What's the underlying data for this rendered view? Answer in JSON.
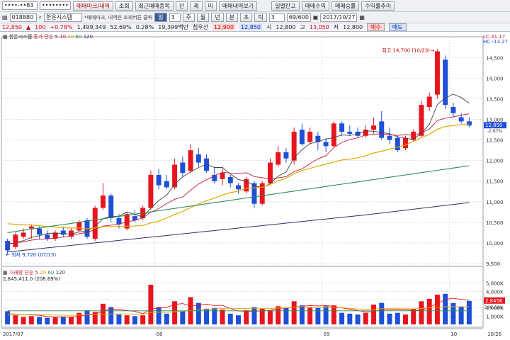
{
  "toolbar1": {
    "account_no": "••••-••83",
    "password": "••••••••",
    "buttons": [
      "매매마크/내역",
      "조회",
      "최근매매종목",
      "잔",
      "체",
      "미",
      "매매내역보기"
    ],
    "right_buttons": [
      "일별잔고",
      "매매수익",
      "매매승률",
      "수익률추이"
    ]
  },
  "toolbar2": {
    "code": "018880",
    "name": "한온시스템",
    "hint": "*매매마크, 내역은 조회버튼 클릭",
    "period": "일",
    "num": "3",
    "modes": [
      "주",
      "월",
      "년",
      "분",
      "초",
      "틱"
    ],
    "count": "3",
    "page": "69/600",
    "date": "2017/10/27"
  },
  "ticker": {
    "price": "12,850",
    "change": "100",
    "change_pct": "+0.78%",
    "volume": "1,499,349",
    "ratio": "52.69%",
    "turnover": "0.28%",
    "trade_value": "19,399백만",
    "pref": "첨우선",
    "pref_price": "12,900",
    "bid": "12,850",
    "open_label": "시",
    "open": "12,800",
    "high_label": "고",
    "high": "13,050",
    "low_label": "저",
    "low": "12,800",
    "buy": "매수",
    "sell": "매도"
  },
  "price_legend": {
    "name": "한온시스템",
    "ma_label": "종가 단순",
    "periods": [
      "5",
      "10",
      "20",
      "60",
      "120"
    ]
  },
  "volume_legend": {
    "name": "거래량",
    "ma_label": "단순",
    "periods": [
      "5",
      "20",
      "60",
      "120"
    ],
    "value": "2,845,411.0 (208.69%)"
  },
  "colors": {
    "up": "#e8141e",
    "down": "#1e4fd8",
    "ma5": "#444444",
    "ma10": "#c41e3a",
    "ma20": "#e0a800",
    "ma60": "#2e8b57",
    "ma120": "#303060",
    "grid": "#d8dde6"
  },
  "chart_data": [
    {
      "type": "candlestick",
      "title": "한온시스템",
      "x_labels": [
        "2017/07",
        "08",
        "09",
        "10",
        "10/26"
      ],
      "ylim": [
        9500,
        14900
      ],
      "y_ticks": [
        "14,500",
        "14,000",
        "13,500",
        "13,000",
        "12,500",
        "12,000",
        "11,500",
        "11,000",
        "10,500",
        "10,000",
        "9,500"
      ],
      "current_label": "12,850",
      "current_value": 12850,
      "lc_label": "LC:31.17",
      "hc_label": "HC:-13.27",
      "pivot_label": "-2.67%",
      "high_annotation": "최고 14,700 (10/23)",
      "low_annotation": "최저 9,720 (07/13)",
      "candles": [
        {
          "o": 10050,
          "c": 9820,
          "h": 10100,
          "l": 9720
        },
        {
          "o": 9900,
          "c": 10200,
          "h": 10250,
          "l": 9850
        },
        {
          "o": 10150,
          "c": 10250,
          "h": 10350,
          "l": 10100
        },
        {
          "o": 10350,
          "c": 10400,
          "h": 10450,
          "l": 10100
        },
        {
          "o": 10350,
          "c": 10200,
          "h": 10400,
          "l": 10100
        },
        {
          "o": 10200,
          "c": 10100,
          "h": 10300,
          "l": 10050
        },
        {
          "o": 10100,
          "c": 10250,
          "h": 10300,
          "l": 10050
        },
        {
          "o": 10300,
          "c": 10200,
          "h": 10400,
          "l": 10150
        },
        {
          "o": 10150,
          "c": 10300,
          "h": 10350,
          "l": 10100
        },
        {
          "o": 10300,
          "c": 10500,
          "h": 10550,
          "l": 10250
        },
        {
          "o": 10550,
          "c": 10150,
          "h": 10600,
          "l": 10100
        },
        {
          "o": 10100,
          "c": 10850,
          "h": 10900,
          "l": 10050
        },
        {
          "o": 10850,
          "c": 11150,
          "h": 11450,
          "l": 10800
        },
        {
          "o": 11150,
          "c": 10600,
          "h": 11200,
          "l": 10500
        },
        {
          "o": 10600,
          "c": 10450,
          "h": 10700,
          "l": 10350
        },
        {
          "o": 10350,
          "c": 10700,
          "h": 10750,
          "l": 10300
        },
        {
          "o": 10650,
          "c": 10550,
          "h": 10800,
          "l": 10500
        },
        {
          "o": 10600,
          "c": 10850,
          "h": 10900,
          "l": 10550
        },
        {
          "o": 10850,
          "c": 11650,
          "h": 11750,
          "l": 10800
        },
        {
          "o": 11650,
          "c": 11400,
          "h": 11800,
          "l": 11300
        },
        {
          "o": 11500,
          "c": 11350,
          "h": 11650,
          "l": 11300
        },
        {
          "o": 11350,
          "c": 11900,
          "h": 12050,
          "l": 11300
        },
        {
          "o": 11950,
          "c": 11700,
          "h": 12100,
          "l": 11600
        },
        {
          "o": 11750,
          "c": 12250,
          "h": 12400,
          "l": 11700
        },
        {
          "o": 12150,
          "c": 11950,
          "h": 12300,
          "l": 11850
        },
        {
          "o": 12050,
          "c": 11750,
          "h": 12150,
          "l": 11700
        },
        {
          "o": 11650,
          "c": 11500,
          "h": 11850,
          "l": 11450
        },
        {
          "o": 11550,
          "c": 11700,
          "h": 11800,
          "l": 11400
        },
        {
          "o": 11600,
          "c": 11450,
          "h": 11650,
          "l": 11350
        },
        {
          "o": 11400,
          "c": 11300,
          "h": 11450,
          "l": 11200
        },
        {
          "o": 11250,
          "c": 11550,
          "h": 11600,
          "l": 11200
        },
        {
          "o": 11450,
          "c": 10950,
          "h": 11500,
          "l": 10850
        },
        {
          "o": 10950,
          "c": 11450,
          "h": 11500,
          "l": 10900
        },
        {
          "o": 11450,
          "c": 11950,
          "h": 12050,
          "l": 11400
        },
        {
          "o": 11900,
          "c": 12200,
          "h": 12350,
          "l": 11850
        },
        {
          "o": 12200,
          "c": 12050,
          "h": 12300,
          "l": 11950
        },
        {
          "o": 12000,
          "c": 12700,
          "h": 12800,
          "l": 11900
        },
        {
          "o": 12750,
          "c": 12400,
          "h": 12900,
          "l": 12350
        },
        {
          "o": 12450,
          "c": 12700,
          "h": 12800,
          "l": 12400
        },
        {
          "o": 12600,
          "c": 12450,
          "h": 12700,
          "l": 12250
        },
        {
          "o": 12450,
          "c": 12350,
          "h": 12550,
          "l": 12200
        },
        {
          "o": 12350,
          "c": 12900,
          "h": 12950,
          "l": 12300
        },
        {
          "o": 12900,
          "c": 12700,
          "h": 12950,
          "l": 12600
        },
        {
          "o": 12700,
          "c": 12650,
          "h": 12850,
          "l": 12600
        },
        {
          "o": 12700,
          "c": 12600,
          "h": 12800,
          "l": 12550
        },
        {
          "o": 12600,
          "c": 12750,
          "h": 12850,
          "l": 12550
        },
        {
          "o": 12750,
          "c": 12850,
          "h": 13050,
          "l": 12650
        },
        {
          "o": 12950,
          "c": 12550,
          "h": 13200,
          "l": 12500
        },
        {
          "o": 12600,
          "c": 12500,
          "h": 12800,
          "l": 12400
        },
        {
          "o": 12550,
          "c": 12250,
          "h": 12600,
          "l": 12200
        },
        {
          "o": 12300,
          "c": 12550,
          "h": 12600,
          "l": 12250
        },
        {
          "o": 12500,
          "c": 12700,
          "h": 12750,
          "l": 12450
        },
        {
          "o": 12600,
          "c": 13350,
          "h": 13450,
          "l": 12550
        },
        {
          "o": 13300,
          "c": 13550,
          "h": 13650,
          "l": 13200
        },
        {
          "o": 13600,
          "c": 14650,
          "h": 14700,
          "l": 13500
        },
        {
          "o": 14450,
          "c": 13350,
          "h": 14550,
          "l": 13250
        },
        {
          "o": 13300,
          "c": 13150,
          "h": 13400,
          "l": 13050
        },
        {
          "o": 13050,
          "c": 12950,
          "h": 13150,
          "l": 12900
        },
        {
          "o": 12950,
          "c": 12850,
          "h": 13050,
          "l": 12800
        }
      ]
    },
    {
      "type": "bar",
      "title": "거래량",
      "ylim": [
        0,
        6000000
      ],
      "y_ticks": [
        "5,000K",
        "4,000K",
        "3,000K",
        "2,000K",
        "1,000K"
      ],
      "current_label": "2,845K",
      "ratio_label": "208.69%",
      "values": [
        1600000,
        1100000,
        900000,
        1000000,
        900000,
        800000,
        850000,
        950000,
        900000,
        1400000,
        1700000,
        1500000,
        2500000,
        2100000,
        1200000,
        1100000,
        1000000,
        1100000,
        4800000,
        2100000,
        1300000,
        2800000,
        1600000,
        3300000,
        2600000,
        1900000,
        2000000,
        1800000,
        1300000,
        1100000,
        1700000,
        2100000,
        1900000,
        1700000,
        2200000,
        2000000,
        2800000,
        2300000,
        2100000,
        2000000,
        2200000,
        2300000,
        1400000,
        1300000,
        1200000,
        1400000,
        2400000,
        2600000,
        1300000,
        1400000,
        1200000,
        1900000,
        2800000,
        3100000,
        3600000,
        3700000,
        2600000,
        2100000,
        2850000
      ]
    }
  ]
}
